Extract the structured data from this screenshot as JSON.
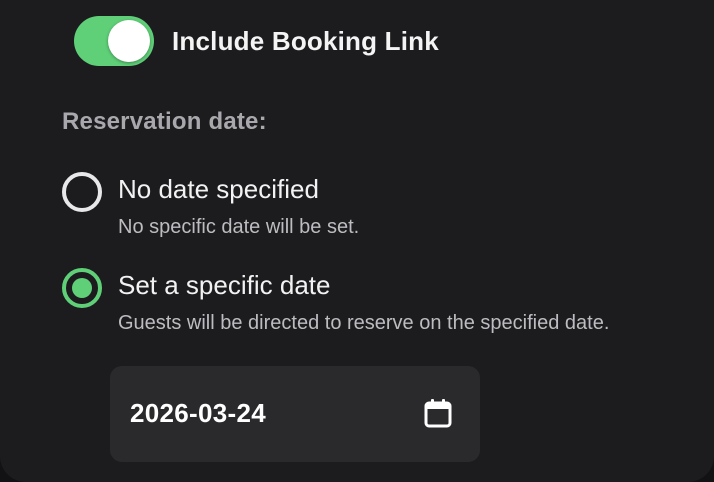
{
  "booking_toggle": {
    "label": "Include Booking Link",
    "enabled": true,
    "on_color": "#5fd078"
  },
  "reservation": {
    "section_label": "Reservation date:",
    "options": [
      {
        "title": "No date specified",
        "description": "No specific date will be set.",
        "selected": false
      },
      {
        "title": "Set a specific date",
        "description": "Guests will be directed to reserve on the specified date.",
        "selected": true
      }
    ],
    "date_input": {
      "value": "2026-03-24",
      "icon": "calendar-icon"
    }
  },
  "colors": {
    "background": "#1c1c1f",
    "accent": "#5fd078",
    "input_background": "#2a2a2d"
  }
}
